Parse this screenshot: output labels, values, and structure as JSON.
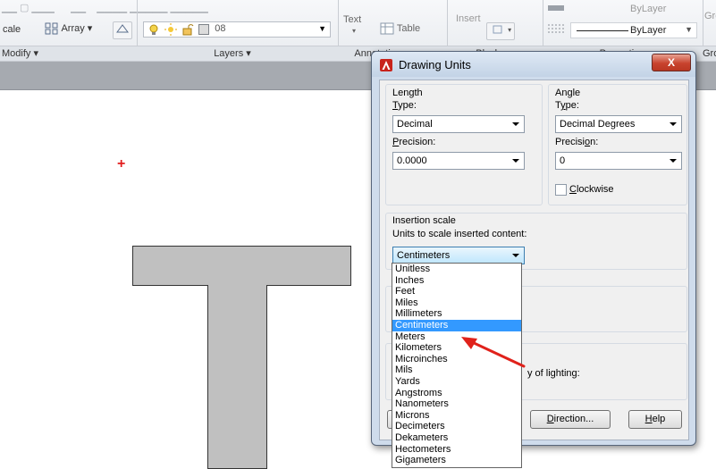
{
  "ribbon": {
    "row1_left": "...",
    "text_label": "Text",
    "insert_label": "Insert",
    "bylayer_top": "ByLayer",
    "scale_label": "cale",
    "array_label": "Array",
    "layer_value": "08",
    "table_label": "Table",
    "linetype_value": "ByLayer",
    "right_clip_1": "Gro",
    "right_clip_2": "Gro",
    "panel_modify": "Modify",
    "panel_layers": "Layers",
    "panel_annotation": "Annotation",
    "panel_block": "Block",
    "panel_properties": "Properties"
  },
  "dialog": {
    "title": "Drawing Units",
    "close_label": "X",
    "length": {
      "group_label": "Length",
      "type_label": "Type:",
      "type_value": "Decimal",
      "precision_label": "Precision:",
      "precision_value": "0.0000"
    },
    "angle": {
      "group_label": "Angle",
      "type_label": "Type:",
      "type_value": "Decimal Degrees",
      "precision_label": "Precision:",
      "precision_value": "0",
      "clockwise_label": "Clockwise",
      "clockwise_checked": false
    },
    "insertion": {
      "group_label": "Insertion scale",
      "units_label": "Units to scale inserted content:",
      "units_value": "Centimeters"
    },
    "lighting_partial": "y of lighting:",
    "buttons": {
      "direction": "Direction...",
      "help": "Help"
    }
  },
  "units_dropdown": {
    "options": [
      "Unitless",
      "Inches",
      "Feet",
      "Miles",
      "Millimeters",
      "Centimeters",
      "Meters",
      "Kilometers",
      "Microinches",
      "Mils",
      "Yards",
      "Angstroms",
      "Nanometers",
      "Microns",
      "Decimeters",
      "Dekameters",
      "Hectometers",
      "Gigameters"
    ],
    "selected_index": 5
  },
  "colors": {
    "selection": "#3399ff",
    "annotation_arrow": "#e0221b",
    "crosshair": "#e21d1d"
  }
}
